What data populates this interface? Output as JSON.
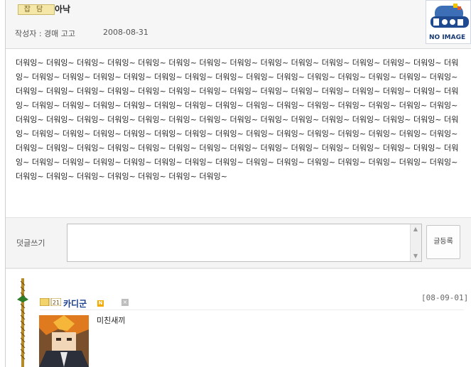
{
  "post": {
    "badge": "잡담",
    "title": "아낙",
    "author": "작성자 : 경매 고고",
    "date": "2008-08-31",
    "thumbnail": {
      "text": "NO IMAGE"
    },
    "body": "더워잉~ 더워잉~ 더워잉~ 더워잉~ 더워잉~ 더워잉~ 더워잉~ 더워잉~ 더워잉~ 더워잉~ 더워잉~ 더워잉~ 더워잉~ 더워잉~ 더워잉~ 더워잉~ 더워잉~ 더워잉~ 더워잉~ 더워잉~ 더워잉~ 더워잉~ 더워잉~ 더워잉~ 더워잉~ 더워잉~ 더워잉~ 더워잉~ 더워잉~ 더워잉~ 더워잉~ 더워잉~ 더워잉~ 더워잉~ 더워잉~ 더워잉~ 더워잉~ 더워잉~ 더워잉~ 더워잉~ 더워잉~ 더워잉~ 더워잉~ 더워잉~ 더워잉~ 더워잉~ 더워잉~ 더워잉~ 더워잉~ 더워잉~ 더워잉~ 더워잉~ 더워잉~ 더워잉~ 더워잉~ 더워잉~ 더워잉~ 더워잉~ 더워잉~ 더워잉~ 더워잉~ 더워잉~ 더워잉~ 더워잉~ 더워잉~ 더워잉~ 더워잉~ 더워잉~ 더워잉~ 더워잉~ 더워잉~ 더워잉~ 더워잉~ 더워잉~ 더워잉~ 더워잉~ 더워잉~ 더워잉~ 더워잉~ 더워잉~ 더워잉~ 더워잉~ 더워잉~ 더워잉~ 더워잉~ 더워잉~ 더워잉~ 더워잉~ 더워잉~ 더워잉~ 더워잉~ 더워잉~ 더워잉~ 더워잉~ 더워잉~ 더워잉~ 더워잉~ 더워잉~ 더워잉~ 더워잉~ 더워잉~ 더워잉~ 더워잉~ 더워잉~ 더워잉~ 더워잉~ 더워잉~ 더워잉~ 더워잉~ 더워잉~ 더워잉~ 더워잉~ 더워잉~ 더워잉~ 더워잉~ 더워잉~ 더워잉~ 더워잉~ 더워잉~ 더워잉~ 더워잉~ 더워잉~ 더워잉~"
  },
  "comment_form": {
    "label": "덧글쓰기",
    "input_value": "",
    "submit_label": "글등록"
  },
  "comments": [
    {
      "level": "21",
      "nickname": "카디군",
      "new_badge": "N",
      "delete_icon": "x-icon",
      "date": "[08-09-01]",
      "text": "미친새끼"
    }
  ]
}
